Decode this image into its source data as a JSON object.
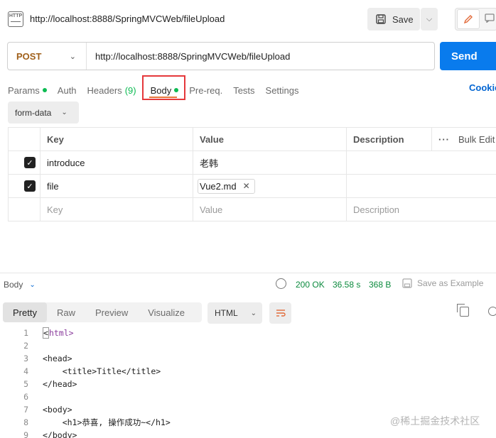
{
  "header": {
    "title": "http://localhost:8888/SpringMVCWeb/fileUpload",
    "save_label": "Save"
  },
  "request": {
    "method": "POST",
    "url": "http://localhost:8888/SpringMVCWeb/fileUpload",
    "send_label": "Send"
  },
  "tabs": {
    "params": "Params",
    "auth": "Auth",
    "headers": "Headers",
    "headers_count": "(9)",
    "body": "Body",
    "prereq": "Pre-req.",
    "tests": "Tests",
    "settings": "Settings",
    "cookies": "Cookie"
  },
  "body_type": "form-data",
  "table": {
    "headers": {
      "key": "Key",
      "value": "Value",
      "description": "Description",
      "bulk_edit": "Bulk Edit"
    },
    "rows": [
      {
        "key": "introduce",
        "value": "老韩",
        "checked": true
      },
      {
        "key": "file",
        "value": "Vue2.md",
        "checked": true
      }
    ],
    "placeholders": {
      "key": "Key",
      "value": "Value",
      "description": "Description"
    }
  },
  "response": {
    "label": "Body",
    "status": "200 OK",
    "time": "36.58 s",
    "size": "368 B",
    "save_example": "Save as Example",
    "view_tabs": [
      "Pretty",
      "Raw",
      "Preview",
      "Visualize"
    ],
    "format": "HTML",
    "code_lines": [
      "<html>",
      "",
      "<head>",
      "    <title>Title</title>",
      "</head>",
      "",
      "<body>",
      "    <h1>恭喜, 操作成功~</h1>",
      "</body>"
    ]
  },
  "watermark": "@稀土掘金技术社区",
  "colors": {
    "send": "#097bed",
    "method": "#a0601b",
    "status_green": "#0b8a3d",
    "highlight_border": "#e5383b",
    "tab_underline": "#e8763a"
  },
  "icons": [
    "http-icon",
    "save-icon",
    "pencil-icon",
    "comment-icon",
    "globe-icon",
    "copy-icon",
    "search-icon",
    "wrap-icon"
  ]
}
